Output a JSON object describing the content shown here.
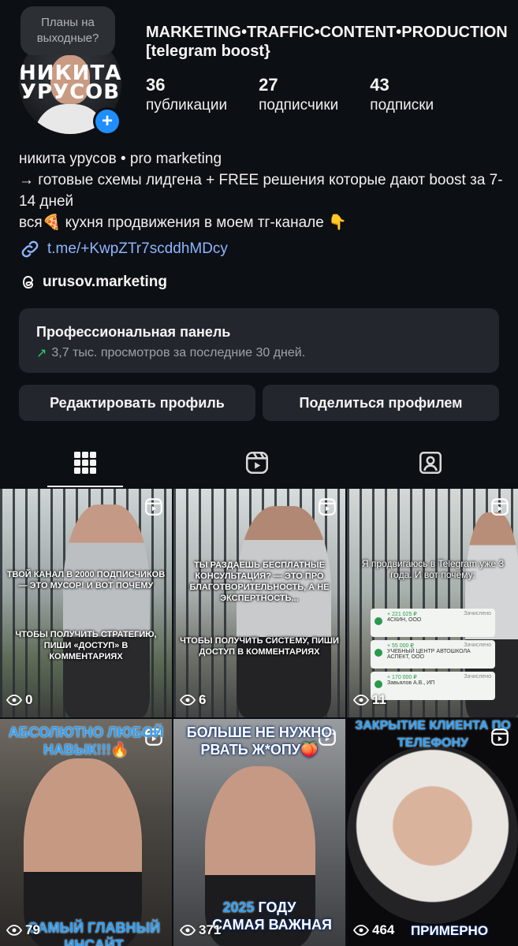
{
  "profile": {
    "note": "Планы на выходные?",
    "avatar_text_line1": "НИКИТА",
    "avatar_text_line2": "УРУСОВ",
    "username": "MARKETING•TRAFFIC•CONTENT•PRODUCTION [telegram boost}",
    "stats": [
      {
        "num": "36",
        "label": "публикации"
      },
      {
        "num": "27",
        "label": "подписчики"
      },
      {
        "num": "43",
        "label": "подписки"
      }
    ],
    "bio_lines": [
      "никита урусов • pro marketing",
      "→ готовые схемы лидгена + FREE решения которые дают boost за 7-14 дней",
      "вся🍕 кухня продвижения в моем тг-канале 👇"
    ],
    "link": "t.me/+KwpZTr7scddhMDcy",
    "threads": "urusov.marketing"
  },
  "pro_panel": {
    "title": "Профессиональная панель",
    "subtitle": "3,7 тыс. просмотров за последние 30 дней."
  },
  "buttons": {
    "edit": "Редактировать профиль",
    "share": "Поделиться профилем"
  },
  "tabs": [
    "grid-icon",
    "reels-icon",
    "tagged-icon"
  ],
  "posts": [
    {
      "views": "0",
      "cap1": "ТВОЙ КАНАЛ В 2000 ПОДПИСЧИКОВ — ЭТО МУСОР! И ВОТ ПОЧЕМУ",
      "cap2": "ЧТОБЫ ПОЛУЧИТЬ СТРАТЕГИЮ, ПИШИ «ДОСТУП» В КОММЕНТАРИЯХ"
    },
    {
      "views": "6",
      "cap1": "ТЫ РАЗДАЕШЬ БЕСПЛАТНЫЕ КОНСУЛЬТАЦИЯ? — ЭТО ПРО БЛАГОТВОРИТЕЛЬНОСТЬ, А НЕ ЭКСПЕРТНОСТЬ...",
      "cap2": "ЧТОБЫ ПОЛУЧИТЬ СИСТЕМУ, ПИШИ ДОСТУП В КОММЕНТАРИЯХ"
    },
    {
      "views": "11",
      "cap1": "Я продвигаюсь в Telegram уже 3 года. И вот почему:",
      "cards": [
        {
          "amount": "+ 221 025 ₽",
          "name": "4СКИН, ООО",
          "status": "Зачислено"
        },
        {
          "amount": "+ 55 000 ₽",
          "name": "УЧЕБНЫЙ ЦЕНТР АВТОШКОЛА АСПЕКТ, ООО",
          "status": "Зачислено"
        },
        {
          "amount": "+ 170 000 ₽",
          "name": "Завьялов А.В., ИП",
          "status": "Зачислено"
        }
      ]
    },
    {
      "views": "79",
      "top": "АБСОЛЮТНО ЛЮБОЙ НАВЫК!!!🔥",
      "bottom": "САМЫЙ ГЛАВНЫЙ ИНСАЙТ"
    },
    {
      "views": "371",
      "top": "БОЛЬШЕ НЕ НУЖНО РВАТЬ Ж*ОПУ🍑",
      "bottom_year": "2025",
      "bottom_mid": "ГОДУ",
      "bottom": "САМАЯ ВАЖНАЯ"
    },
    {
      "views": "464",
      "top": "ЗАКРЫТИЕ КЛИЕНТА ПО ТЕЛЕФОНУ",
      "bottom": "ПРИМЕРНО"
    }
  ]
}
